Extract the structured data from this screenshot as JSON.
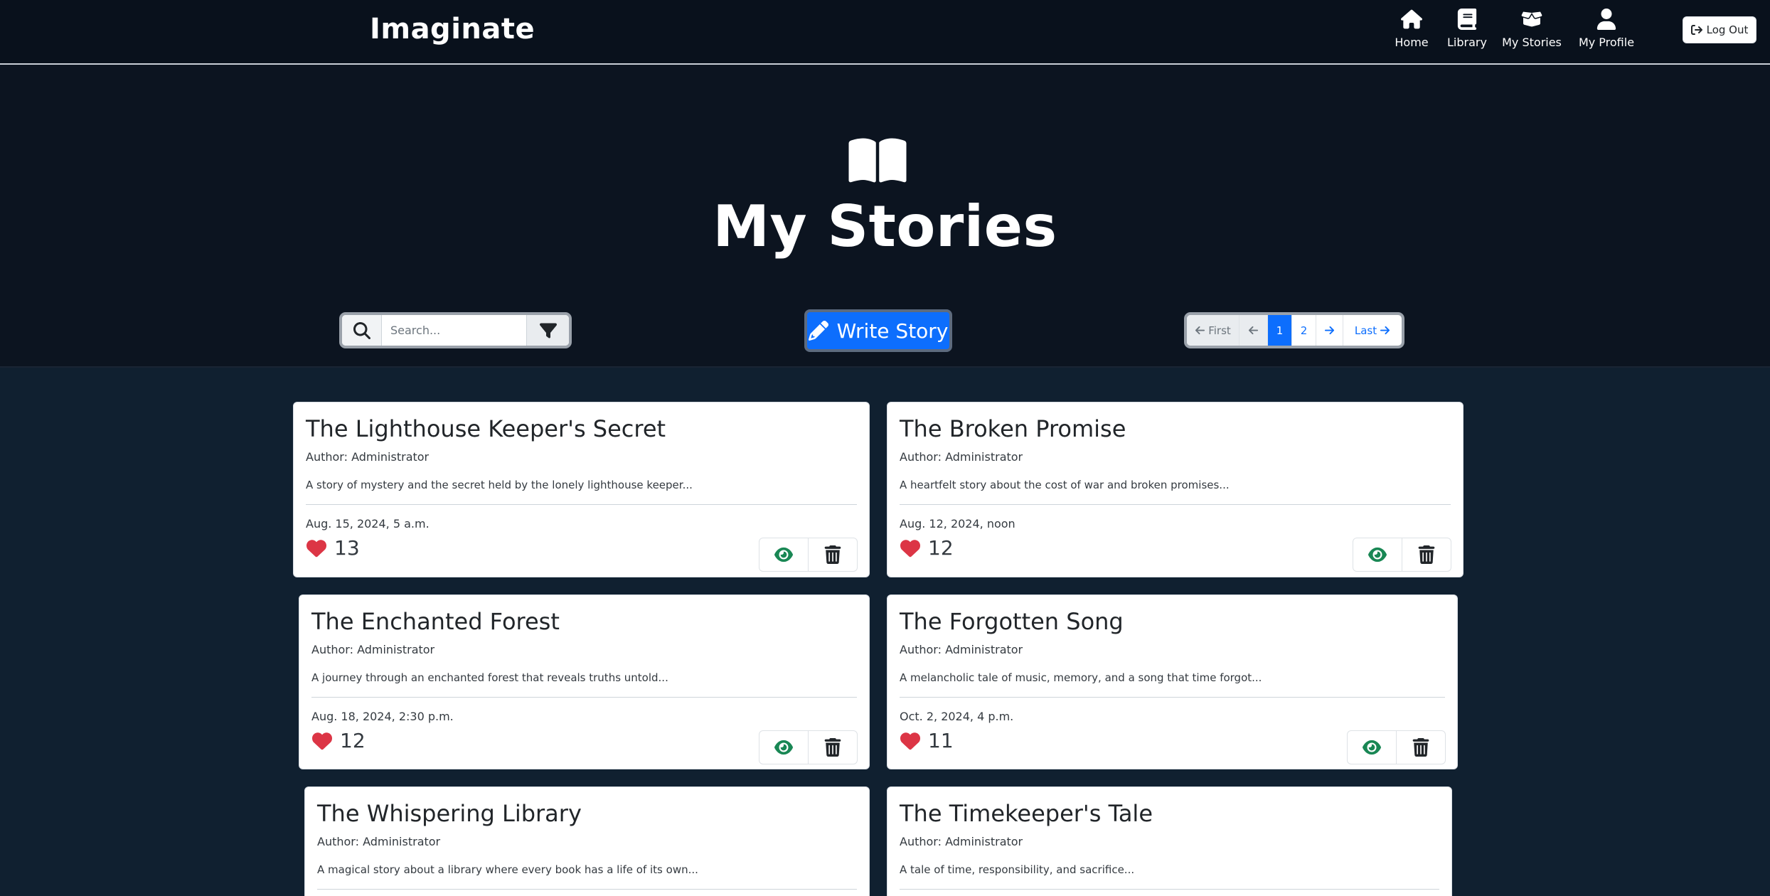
{
  "nav": {
    "brand": "Imaginate",
    "items": [
      {
        "label": "Home",
        "icon": "home-icon"
      },
      {
        "label": "Library",
        "icon": "book-icon"
      },
      {
        "label": "My Stories",
        "icon": "box-open-icon"
      },
      {
        "label": "My Profile",
        "icon": "user-icon"
      }
    ],
    "logout_label": "Log Out"
  },
  "hero": {
    "title": "My Stories",
    "icon": "book-open-icon"
  },
  "controls": {
    "search_placeholder": "Search...",
    "search_value": "",
    "write_label": "Write Story",
    "pagination": {
      "first": "First",
      "prev_icon": "arrow-left-icon",
      "pages": [
        "1",
        "2"
      ],
      "current_page": "1",
      "next_icon": "arrow-right-icon",
      "last": "Last"
    }
  },
  "colors": {
    "background": "#0c1420",
    "primary": "#0d6efd",
    "heart": "#dc3545",
    "view": "#198754"
  },
  "stories": [
    {
      "title": "The Lighthouse Keeper's Secret",
      "author": "Author: Administrator",
      "description": "A story of mystery and the secret held by the lonely lighthouse keeper...",
      "date": "Aug. 15, 2024, 5 a.m.",
      "likes": "13"
    },
    {
      "title": "The Broken Promise",
      "author": "Author: Administrator",
      "description": "A heartfelt story about the cost of war and broken promises...",
      "date": "Aug. 12, 2024, noon",
      "likes": "12"
    },
    {
      "title": "The Enchanted Forest",
      "author": "Author: Administrator",
      "description": "A journey through an enchanted forest that reveals truths untold...",
      "date": "Aug. 18, 2024, 2:30 p.m.",
      "likes": "12"
    },
    {
      "title": "The Forgotten Song",
      "author": "Author: Administrator",
      "description": "A melancholic tale of music, memory, and a song that time forgot...",
      "date": "Oct. 2, 2024, 4 p.m.",
      "likes": "11"
    },
    {
      "title": "The Whispering Library",
      "author": "Author: Administrator",
      "description": "A magical story about a library where every book has a life of its own..."
    },
    {
      "title": "The Timekeeper's Tale",
      "author": "Author: Administrator",
      "description": "A tale of time, responsibility, and sacrifice..."
    }
  ]
}
